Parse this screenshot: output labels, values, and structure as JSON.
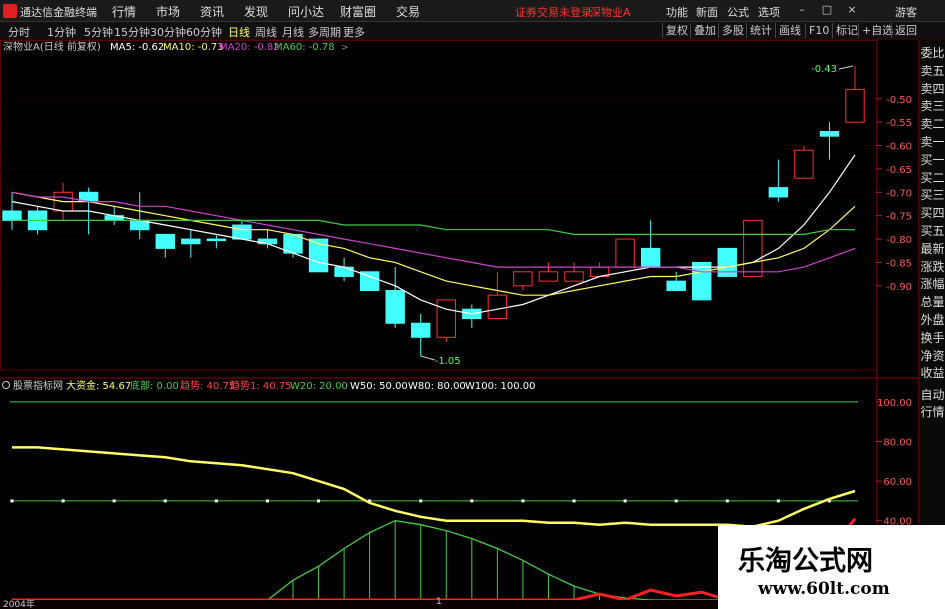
{
  "app": {
    "title": "通达信金融终端"
  },
  "main_menu": [
    "行情",
    "市场",
    "资讯",
    "发现",
    "问小达",
    "财富圈",
    "交易"
  ],
  "status": {
    "login": "证券交易未登录",
    "stock_title": "深物业A"
  },
  "right_menu": [
    "功能",
    "新面",
    "公式",
    "选项",
    "游客"
  ],
  "window_controls": {
    "minimize": "–",
    "maximize": "□",
    "close": "×"
  },
  "periods": [
    {
      "label": "分时",
      "active": false
    },
    {
      "label": "1分钟",
      "active": false
    },
    {
      "label": "5分钟",
      "active": false
    },
    {
      "label": "15分钟",
      "active": false
    },
    {
      "label": "30分钟",
      "active": false
    },
    {
      "label": "60分钟",
      "active": false
    },
    {
      "label": "日线",
      "active": true
    },
    {
      "label": "周线",
      "active": false
    },
    {
      "label": "月线",
      "active": false
    },
    {
      "label": "多周期",
      "active": false
    },
    {
      "label": "更多",
      "active": false
    }
  ],
  "period_right_buttons": [
    "复权",
    "叠加",
    "多股",
    "统计",
    "画线",
    "F10",
    "标记",
    "+自选",
    "返回"
  ],
  "side_menu_top": [
    "委比",
    "卖五",
    "卖四",
    "卖三",
    "卖二",
    "卖一",
    "买一",
    "买二",
    "买三",
    "买四",
    "买五",
    "最新",
    "涨跌",
    "涨幅",
    "总量",
    "外盘",
    "换手",
    "净资",
    "收益"
  ],
  "side_menu_bottom": [
    "自动",
    "行情"
  ],
  "main_panel": {
    "stock_label": "深物业A(日线 前复权)",
    "ma": [
      {
        "label": "MA5: -0.62",
        "color": "#ffffff"
      },
      {
        "label": "MA10: -0.73",
        "color": "#ffff66"
      },
      {
        "label": "MA20: -0.82",
        "color": "#cc44cc"
      },
      {
        "label": "MA60: -0.78",
        "color": "#44cc44"
      }
    ],
    "high_label": "-0.43",
    "low_label": "-1.05"
  },
  "sub_panel": {
    "indicator_name": "股票指标网",
    "values": [
      {
        "label": "大资金: 54.67",
        "color": "#ffff66"
      },
      {
        "label": "底部: 0.00",
        "color": "#44cc44"
      },
      {
        "label": "趋势: 40.75",
        "color": "#ff4444"
      },
      {
        "label": "趋势1: 40.75",
        "color": "#ff4444"
      },
      {
        "label": "W20: 20.00",
        "color": "#44cc44"
      },
      {
        "label": "W50: 50.00",
        "color": "#ffffff"
      },
      {
        "label": "W80: 80.00",
        "color": "#ffffff"
      },
      {
        "label": "W100: 100.00",
        "color": "#ffffff"
      }
    ]
  },
  "bottom_bar": {
    "year_label": "2004年",
    "marker_label": "1"
  },
  "watermark": {
    "title": "乐淘公式网",
    "url": "www.60lt.com"
  },
  "chart_data": [
    {
      "type": "candlestick",
      "ylim": [
        -1.08,
        -0.4
      ],
      "y_ticks": [
        "-0.50",
        "-0.55",
        "-0.60",
        "-0.65",
        "-0.70",
        "-0.75",
        "-0.80",
        "-0.85",
        "-0.90"
      ],
      "y_tick_values": [
        -0.5,
        -0.55,
        -0.6,
        -0.65,
        -0.7,
        -0.75,
        -0.8,
        -0.85,
        -0.9
      ],
      "candles": [
        {
          "o": -0.74,
          "c": -0.76,
          "h": -0.7,
          "l": -0.78
        },
        {
          "o": -0.74,
          "c": -0.78,
          "h": -0.73,
          "l": -0.79
        },
        {
          "o": -0.74,
          "c": -0.7,
          "h": -0.68,
          "l": -0.76
        },
        {
          "o": -0.7,
          "c": -0.72,
          "h": -0.69,
          "l": -0.79
        },
        {
          "o": -0.75,
          "c": -0.76,
          "h": -0.73,
          "l": -0.77
        },
        {
          "o": -0.76,
          "c": -0.78,
          "h": -0.7,
          "l": -0.8
        },
        {
          "o": -0.79,
          "c": -0.82,
          "h": -0.79,
          "l": -0.84
        },
        {
          "o": -0.8,
          "c": -0.81,
          "h": -0.78,
          "l": -0.84
        },
        {
          "o": -0.8,
          "c": -0.8,
          "h": -0.79,
          "l": -0.82
        },
        {
          "o": -0.77,
          "c": -0.8,
          "h": -0.76,
          "l": -0.8
        },
        {
          "o": -0.8,
          "c": -0.81,
          "h": -0.78,
          "l": -0.82
        },
        {
          "o": -0.79,
          "c": -0.83,
          "h": -0.79,
          "l": -0.84
        },
        {
          "o": -0.8,
          "c": -0.87,
          "h": -0.8,
          "l": -0.87
        },
        {
          "o": -0.86,
          "c": -0.88,
          "h": -0.84,
          "l": -0.89
        },
        {
          "o": -0.87,
          "c": -0.91,
          "h": -0.87,
          "l": -0.91
        },
        {
          "o": -0.91,
          "c": -0.98,
          "h": -0.86,
          "l": -0.99
        },
        {
          "o": -0.98,
          "c": -1.01,
          "h": -0.96,
          "l": -1.05
        },
        {
          "o": -1.01,
          "c": -0.93,
          "h": -0.93,
          "l": -1.02
        },
        {
          "o": -0.95,
          "c": -0.97,
          "h": -0.94,
          "l": -0.99
        },
        {
          "o": -0.97,
          "c": -0.92,
          "h": -0.87,
          "l": -0.97
        },
        {
          "o": -0.9,
          "c": -0.87,
          "h": -0.87,
          "l": -0.91
        },
        {
          "o": -0.89,
          "c": -0.87,
          "h": -0.85,
          "l": -0.89
        },
        {
          "o": -0.89,
          "c": -0.87,
          "h": -0.85,
          "l": -0.89
        },
        {
          "o": -0.88,
          "c": -0.86,
          "h": -0.85,
          "l": -0.88
        },
        {
          "o": -0.86,
          "c": -0.8,
          "h": -0.8,
          "l": -0.86
        },
        {
          "o": -0.82,
          "c": -0.86,
          "h": -0.76,
          "l": -0.86
        },
        {
          "o": -0.89,
          "c": -0.91,
          "h": -0.87,
          "l": -0.91
        },
        {
          "o": -0.85,
          "c": -0.93,
          "h": -0.85,
          "l": -0.93
        },
        {
          "o": -0.82,
          "c": -0.88,
          "h": -0.82,
          "l": -0.88
        },
        {
          "o": -0.88,
          "c": -0.76,
          "h": -0.76,
          "l": -0.88
        },
        {
          "o": -0.69,
          "c": -0.71,
          "h": -0.63,
          "l": -0.72
        },
        {
          "o": -0.67,
          "c": -0.61,
          "h": -0.6,
          "l": -0.67
        },
        {
          "o": -0.57,
          "c": -0.58,
          "h": -0.55,
          "l": -0.63
        },
        {
          "o": -0.55,
          "c": -0.48,
          "h": -0.43,
          "l": -0.55
        }
      ],
      "series": [
        {
          "name": "MA5",
          "color": "#ffffff",
          "values": [
            -0.72,
            -0.73,
            -0.74,
            -0.74,
            -0.75,
            -0.76,
            -0.77,
            -0.78,
            -0.79,
            -0.8,
            -0.81,
            -0.83,
            -0.85,
            -0.86,
            -0.88,
            -0.9,
            -0.93,
            -0.95,
            -0.96,
            -0.95,
            -0.94,
            -0.92,
            -0.9,
            -0.88,
            -0.87,
            -0.86,
            -0.86,
            -0.86,
            -0.86,
            -0.85,
            -0.82,
            -0.77,
            -0.7,
            -0.62
          ]
        },
        {
          "name": "MA10",
          "color": "#ffff66",
          "values": [
            -0.7,
            -0.71,
            -0.72,
            -0.72,
            -0.73,
            -0.74,
            -0.75,
            -0.76,
            -0.77,
            -0.78,
            -0.78,
            -0.79,
            -0.81,
            -0.82,
            -0.84,
            -0.85,
            -0.87,
            -0.89,
            -0.9,
            -0.91,
            -0.92,
            -0.92,
            -0.91,
            -0.9,
            -0.89,
            -0.88,
            -0.88,
            -0.87,
            -0.86,
            -0.85,
            -0.84,
            -0.82,
            -0.78,
            -0.73
          ]
        },
        {
          "name": "MA20",
          "color": "#cc44cc",
          "values": [
            -0.7,
            -0.71,
            -0.71,
            -0.72,
            -0.72,
            -0.73,
            -0.73,
            -0.74,
            -0.75,
            -0.76,
            -0.77,
            -0.78,
            -0.79,
            -0.8,
            -0.81,
            -0.82,
            -0.83,
            -0.84,
            -0.85,
            -0.86,
            -0.86,
            -0.86,
            -0.86,
            -0.86,
            -0.86,
            -0.86,
            -0.86,
            -0.87,
            -0.87,
            -0.87,
            -0.87,
            -0.86,
            -0.84,
            -0.82
          ]
        },
        {
          "name": "MA60",
          "color": "#44cc44",
          "values": [
            -0.76,
            -0.76,
            -0.76,
            -0.76,
            -0.76,
            -0.76,
            -0.76,
            -0.76,
            -0.76,
            -0.76,
            -0.76,
            -0.76,
            -0.76,
            -0.77,
            -0.77,
            -0.77,
            -0.77,
            -0.78,
            -0.78,
            -0.78,
            -0.78,
            -0.78,
            -0.79,
            -0.79,
            -0.79,
            -0.79,
            -0.79,
            -0.79,
            -0.79,
            -0.79,
            -0.79,
            -0.79,
            -0.78,
            -0.78
          ]
        }
      ]
    },
    {
      "type": "line",
      "ylim": [
        0,
        108
      ],
      "y_ticks": [
        "100.00",
        "80.00",
        "60.00",
        "40.00"
      ],
      "y_tick_values": [
        100,
        80,
        60,
        40
      ],
      "levels": [
        {
          "name": "W100",
          "value": 100,
          "color": "#44cc44"
        },
        {
          "name": "W50",
          "value": 50,
          "color": "#44cc44"
        }
      ],
      "series": [
        {
          "name": "大资金",
          "color": "#ffff66",
          "values": [
            77,
            77,
            76,
            75,
            74,
            73,
            72,
            70,
            69,
            68,
            66,
            64,
            60,
            56,
            49,
            45,
            42,
            40,
            40,
            40,
            40,
            39,
            39,
            38,
            39,
            38,
            38,
            38,
            38,
            37,
            40,
            46,
            51,
            55
          ]
        },
        {
          "name": "底部",
          "color": "#44cc44",
          "values": [
            0,
            0,
            0,
            0,
            0,
            0,
            0,
            0,
            0,
            0,
            0,
            10,
            17,
            26,
            34,
            40,
            38,
            35,
            31,
            26,
            20,
            13,
            7,
            3,
            1,
            0,
            0,
            0,
            0,
            0,
            0,
            0,
            0,
            0
          ]
        },
        {
          "name": "趋势",
          "color": "#ff2020",
          "values": [
            0,
            0,
            0,
            0,
            0,
            0,
            0,
            0,
            0,
            0,
            0,
            0,
            0,
            0,
            0,
            0,
            0,
            0,
            0,
            0,
            0,
            0,
            0,
            3,
            0,
            5,
            2,
            4,
            0,
            0,
            4,
            10,
            25,
            41
          ]
        }
      ]
    }
  ]
}
